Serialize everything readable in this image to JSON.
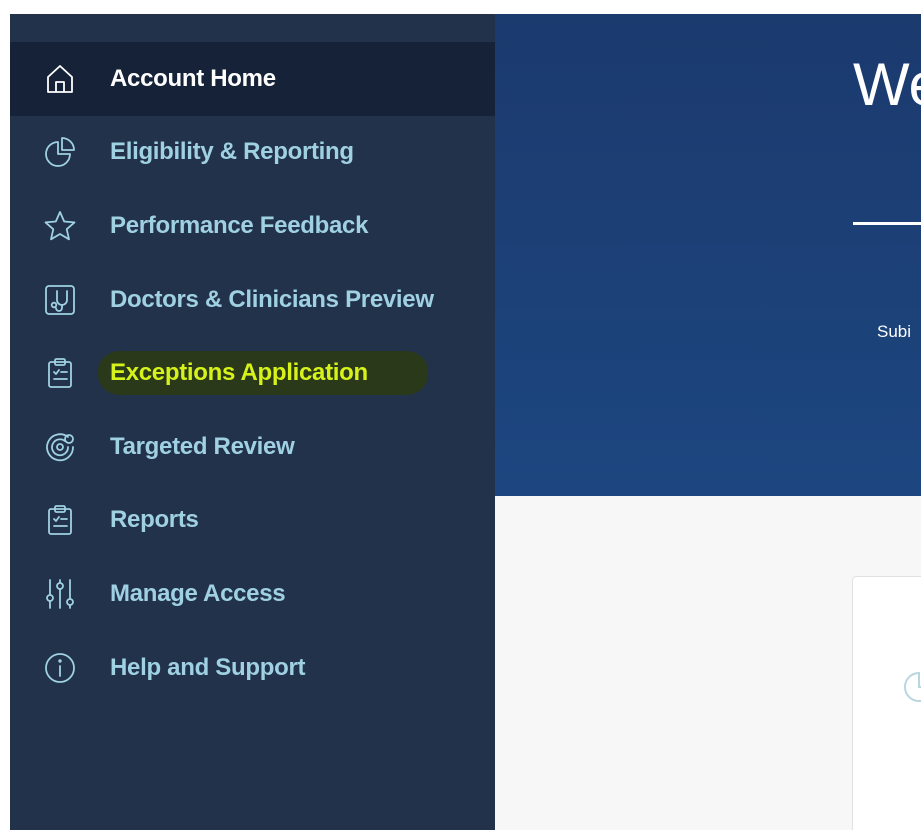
{
  "sidebar": {
    "items": [
      {
        "label": "Account Home",
        "icon": "home-icon",
        "state": "active"
      },
      {
        "label": "Eligibility & Reporting",
        "icon": "pie-chart-icon",
        "state": "default"
      },
      {
        "label": "Performance Feedback",
        "icon": "star-icon",
        "state": "default"
      },
      {
        "label": "Doctors & Clinicians Preview",
        "icon": "stethoscope-icon",
        "state": "default"
      },
      {
        "label": "Exceptions Application",
        "icon": "clipboard-icon",
        "state": "highlighted"
      },
      {
        "label": "Targeted Review",
        "icon": "target-review-icon",
        "state": "default"
      },
      {
        "label": "Reports",
        "icon": "clipboard-icon",
        "state": "default"
      },
      {
        "label": "Manage Access",
        "icon": "sliders-icon",
        "state": "default"
      },
      {
        "label": "Help and Support",
        "icon": "info-icon",
        "state": "default"
      }
    ]
  },
  "banner": {
    "welcome": "We",
    "subtitle": "Subi"
  },
  "card": {
    "icon": "pie-chart-icon"
  },
  "colors": {
    "sidebar_bg": "#22324a",
    "active_bg": "#162238",
    "nav_text": "#9fd1e3",
    "highlight_text": "#d6f21a",
    "banner_bg": "#1b3a6e"
  }
}
